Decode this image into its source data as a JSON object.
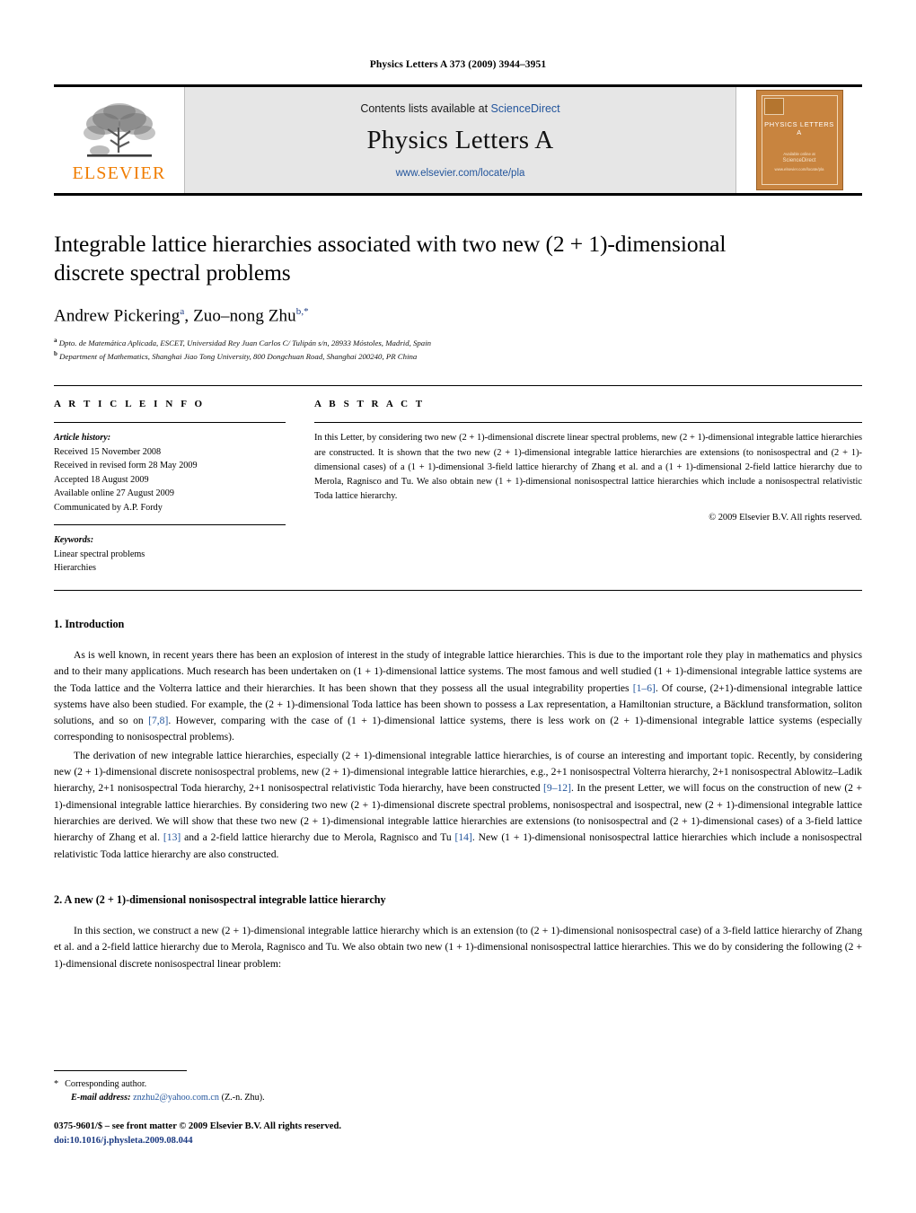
{
  "running_head": "Physics Letters A 373 (2009) 3944–3951",
  "masthead": {
    "publisher_name": "ELSEVIER",
    "contents_prefix": "Contents lists available at ",
    "contents_link": "ScienceDirect",
    "journal_title": "Physics Letters A",
    "journal_url": "www.elsevier.com/locate/pla",
    "cover_title": "PHYSICS LETTERS A",
    "cover_foot_line1": "Available online at",
    "cover_foot_line2": "ScienceDirect",
    "cover_foot_line3": "www.elsevier.com/locate/pla"
  },
  "article": {
    "title": "Integrable lattice hierarchies associated with two new (2 + 1)-dimensional discrete spectral problems",
    "authors": [
      {
        "name": "Andrew Pickering",
        "marker": "a"
      },
      {
        "name": "Zuo–nong Zhu",
        "marker": "b,*"
      }
    ],
    "affiliations": [
      {
        "marker": "a",
        "text": "Dpto. de Matemática Aplicada, ESCET, Universidad Rey Juan Carlos C/ Tulipán s/n, 28933 Móstoles, Madrid, Spain"
      },
      {
        "marker": "b",
        "text": "Department of Mathematics, Shanghai Jiao Tong University, 800 Dongchuan Road, Shanghai 200240, PR China"
      }
    ]
  },
  "info": {
    "heading": "A R T I C L E   I N F O",
    "history_label": "Article history:",
    "history": [
      "Received 15 November 2008",
      "Received in revised form 28 May 2009",
      "Accepted 18 August 2009",
      "Available online 27 August 2009",
      "Communicated by A.P. Fordy"
    ],
    "keywords_label": "Keywords:",
    "keywords": [
      "Linear spectral problems",
      "Hierarchies"
    ]
  },
  "abstract": {
    "heading": "A B S T R A C T",
    "text": "In this Letter, by considering two new (2 + 1)-dimensional discrete linear spectral problems, new (2 + 1)-dimensional integrable lattice hierarchies are constructed. It is shown that the two new (2 + 1)-dimensional integrable lattice hierarchies are extensions (to nonisospectral and (2 + 1)-dimensional cases) of a (1 + 1)-dimensional 3-field lattice hierarchy of Zhang et al. and a (1 + 1)-dimensional 2-field lattice hierarchy due to Merola, Ragnisco and Tu. We also obtain new (1 + 1)-dimensional nonisospectral lattice hierarchies which include a nonisospectral relativistic Toda lattice hierarchy.",
    "copyright": "© 2009 Elsevier B.V. All rights reserved."
  },
  "sections": [
    {
      "heading": "1.  Introduction",
      "paragraphs": [
        {
          "parts": [
            {
              "t": "As is well known, in recent years there has been an explosion of interest in the study of integrable lattice hierarchies. This is due to the important role they play in mathematics and physics and to their many applications. Much research has been undertaken on (1 + 1)-dimensional lattice systems. The most famous and well studied (1 + 1)-dimensional integrable lattice systems are the Toda lattice and the Volterra lattice and their hierarchies. It has been shown that they possess all the usual integrability properties ",
              "cite": false
            },
            {
              "t": "[1–6]",
              "cite": true
            },
            {
              "t": ". Of course, (2+1)-dimensional integrable lattice systems have also been studied. For example, the (2 + 1)-dimensional Toda lattice has been shown to possess a Lax representation, a Hamiltonian structure, a Bäcklund transformation, soliton solutions, and so on ",
              "cite": false
            },
            {
              "t": "[7,8]",
              "cite": true
            },
            {
              "t": ". However, comparing with the case of (1 + 1)-dimensional lattice systems, there is less work on (2 + 1)-dimensional integrable lattice systems (especially corresponding to nonisospectral problems).",
              "cite": false
            }
          ]
        },
        {
          "parts": [
            {
              "t": "The derivation of new integrable lattice hierarchies, especially (2 + 1)-dimensional integrable lattice hierarchies, is of course an interesting and important topic. Recently, by considering new (2 + 1)-dimensional discrete nonisospectral problems, new (2 + 1)-dimensional integrable lattice hierarchies, e.g., 2+1 nonisospectral Volterra hierarchy, 2+1 nonisospectral Ablowitz–Ladik hierarchy, 2+1 nonisospectral Toda hierarchy, 2+1 nonisospectral relativistic Toda hierarchy, have been constructed ",
              "cite": false
            },
            {
              "t": "[9–12]",
              "cite": true
            },
            {
              "t": ". In the present Letter, we will focus on the construction of new (2 + 1)-dimensional integrable lattice hierarchies. By considering two new (2 + 1)-dimensional discrete spectral problems, nonisospectral and isospectral, new (2 + 1)-dimensional integrable lattice hierarchies are derived. We will show that these two new (2 + 1)-dimensional integrable lattice hierarchies are extensions (to nonisospectral and (2 + 1)-dimensional cases) of a 3-field lattice hierarchy of Zhang et al. ",
              "cite": false
            },
            {
              "t": "[13]",
              "cite": true
            },
            {
              "t": " and a 2-field lattice hierarchy due to Merola, Ragnisco and Tu ",
              "cite": false
            },
            {
              "t": "[14]",
              "cite": true
            },
            {
              "t": ". New (1 + 1)-dimensional nonisospectral lattice hierarchies which include a nonisospectral relativistic Toda lattice hierarchy are also constructed.",
              "cite": false
            }
          ]
        }
      ]
    },
    {
      "heading": "2.  A new (2 + 1)-dimensional nonisospectral integrable lattice hierarchy",
      "paragraphs": [
        {
          "parts": [
            {
              "t": "In this section, we construct a new (2 + 1)-dimensional integrable lattice hierarchy which is an extension (to (2 + 1)-dimensional nonisospectral case) of a 3-field lattice hierarchy of Zhang et al. and a 2-field lattice hierarchy due to Merola, Ragnisco and Tu. We also obtain two new (1 + 1)-dimensional nonisospectral lattice hierarchies. This we do by considering the following (2 + 1)-dimensional discrete nonisospectral linear problem:",
              "cite": false
            }
          ]
        }
      ]
    }
  ],
  "footer": {
    "corresponding_marker": "*",
    "corresponding_text": "Corresponding author.",
    "email_label": "E-mail address:",
    "email": "znzhu2@yahoo.com.cn",
    "email_attrib": "(Z.-n. Zhu).",
    "imprint": "0375-9601/$ – see front matter  © 2009 Elsevier B.V. All rights reserved.",
    "doi": "doi:10.1016/j.physleta.2009.08.044"
  },
  "colors": {
    "link": "#23559c",
    "elsevier_orange": "#f07d00",
    "banner_gray": "#e6e6e6",
    "cover_orange": "#c8843f"
  }
}
